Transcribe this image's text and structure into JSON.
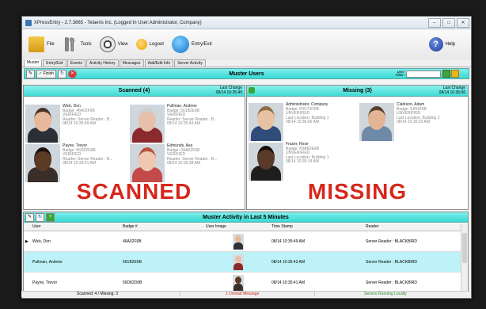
{
  "window": {
    "title": "XPressEntry - 2.7.3865 - Telaeris Inc. (Logged In User:Administrator, Company)"
  },
  "toolbar": {
    "file": "File",
    "tools": "Tools",
    "view": "View",
    "logout": "Logout",
    "entry_exit": "Entry/Exit",
    "help": "Help"
  },
  "tabs": [
    "Muster",
    "Entry/Exit",
    "Events",
    "Activity History",
    "Messages",
    "Add/Edit Info",
    "Server Activity"
  ],
  "muster": {
    "title": "Muster Users",
    "finish_label": "Finish",
    "filter_label": "User Filter:",
    "filter_value": ""
  },
  "scanned": {
    "title": "Scanned (4)",
    "last_change_label": "Last Change",
    "last_change": "08/14 10:35:49",
    "big_label": "SCANNED",
    "people": [
      {
        "name": "Wick, Don",
        "badge": "Badge: 46A02F6B",
        "status": "VERIFIED",
        "reader": "Reader: Server Reader : B...",
        "time": "08/14 10:35:49 AM",
        "skin": "#e7b99a",
        "hair": "#4a3525",
        "shirt": "#2b2f36"
      },
      {
        "name": "Pullman, Andrew",
        "badge": "Badge: 561B2E6B",
        "status": "VERIFIED",
        "reader": "Reader: Server Reader : B...",
        "time": "08/14 10:35:43 AM",
        "skin": "#e8bfa8",
        "hair": "#cfcfcf",
        "shirt": "#8a2a2e"
      },
      {
        "name": "Payne, Trevor",
        "badge": "Badge: 56D82D6B",
        "status": "VERIFIED",
        "reader": "Reader: Server Reader : B...",
        "time": "08/14 10:35:41 AM",
        "skin": "#5b3a26",
        "hair": "#1b120c",
        "shirt": "#3a2e28"
      },
      {
        "name": "Edmunds, Ava",
        "badge": "Badge: 0AA02F6B",
        "status": "VERIFIED",
        "reader": "Reader: Server Reader : B...",
        "time": "08/14 10:35:38 AM",
        "skin": "#f0c8b0",
        "hair": "#b8533a",
        "shirt": "#c44a4a"
      }
    ]
  },
  "missing": {
    "title": "Missing (3)",
    "last_change_label": "Last Change",
    "last_change": "08/14 10:36:06",
    "big_label": "MISSING",
    "people": [
      {
        "name": "Administrator, Company",
        "badge": "Badge: F0C73D6B",
        "status": "UNVERIFIED",
        "location": "Last Location: Building 1",
        "time": "08/14 10:36:06 AM",
        "skin": "#e8c2a2",
        "hair": "#8f6a47",
        "shirt": "#2f4c7a"
      },
      {
        "name": "Clarkson, Adam",
        "badge": "Badge: E65426B",
        "status": "UNVERIFIED",
        "location": "Last Location: Building 2",
        "time": "08/14 10:35:20 AM",
        "skin": "#e3b596",
        "hair": "#5a4030",
        "shirt": "#6f8aa6"
      },
      {
        "name": "Fraser, Rose",
        "badge": "Badge: F8AB2E6B",
        "status": "UNVERIFIED",
        "location": "Last Location: Building 1",
        "time": "08/14 10:35:14 AM",
        "skin": "#5a3a28",
        "hair": "#140d09",
        "shirt": "#1e1e1e"
      }
    ]
  },
  "activity": {
    "title": "Muster Activity in Last 5 Minutes",
    "columns": [
      "User",
      "Badge #",
      "User Image",
      "Time Stamp",
      "Reader"
    ],
    "rows": [
      {
        "user": "Wick, Don",
        "badge": "46A02F6B",
        "time": "08/14 10:35:49 AM",
        "reader": "Server Reader : BLACKBIRD",
        "skin": "#e7b99a",
        "shirt": "#2b2f36"
      },
      {
        "user": "Pullman, Andrew",
        "badge": "561B2E6B",
        "time": "08/14 10:35:43 AM",
        "reader": "Server Reader : BLACKBIRD",
        "skin": "#e8bfa8",
        "shirt": "#8a2a2e"
      },
      {
        "user": "Payne, Trevor",
        "badge": "56D82D6B",
        "time": "08/14 10:35:41 AM",
        "reader": "Server Reader : BLACKBIRD",
        "skin": "#5b3a26",
        "shirt": "#3a2e28"
      }
    ]
  },
  "status": {
    "counts": "Scanned: 4 / Missing: 3",
    "message": "1 Unread Message",
    "service": "Service Running Locally",
    "colors": {
      "message": "#d0231a",
      "service": "#2a8a2a"
    }
  }
}
